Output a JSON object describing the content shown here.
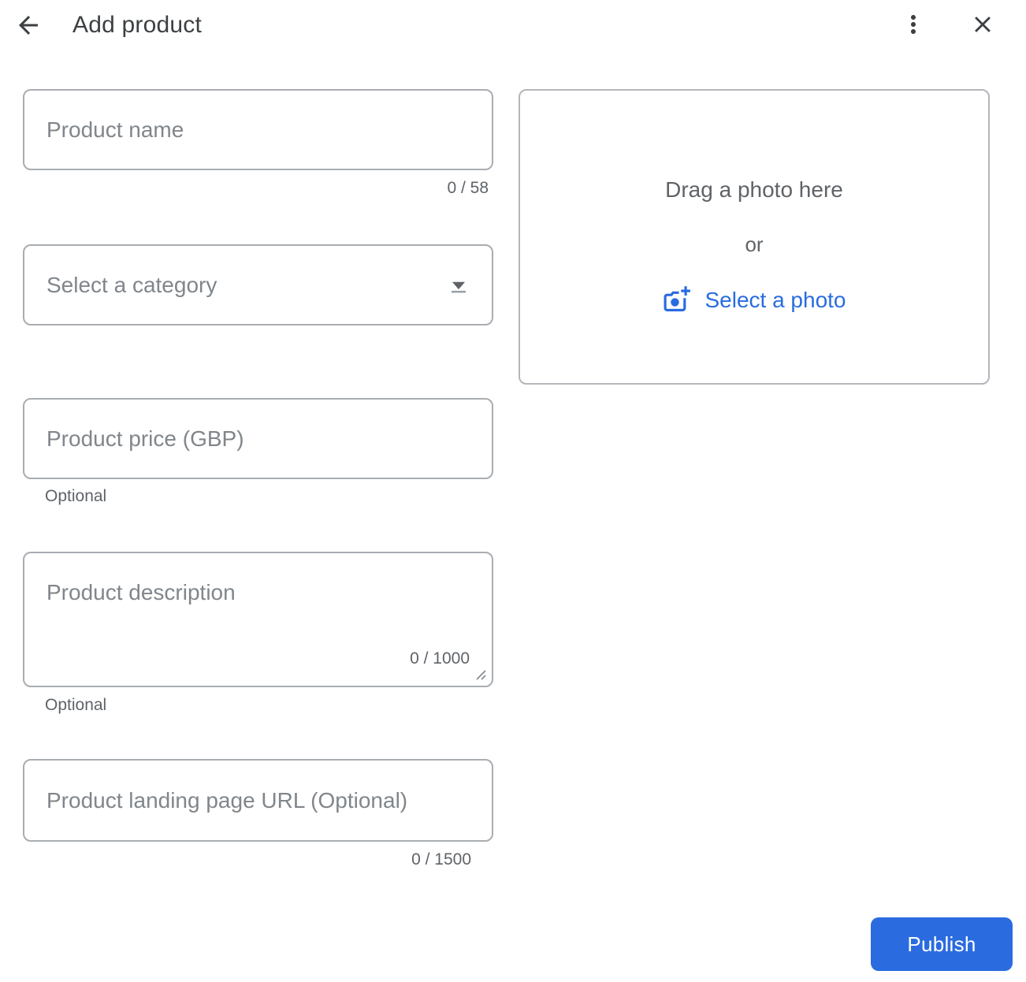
{
  "header": {
    "title": "Add product",
    "back_icon": "arrow-back",
    "more_icon": "more-vert",
    "close_icon": "close"
  },
  "form": {
    "product_name": {
      "value": "",
      "placeholder": "Product name",
      "counter": "0 / 58"
    },
    "category": {
      "selected": "Select a category",
      "dropdown_icon": "arrow-drop-down"
    },
    "price": {
      "value": "",
      "placeholder": "Product price (GBP)",
      "helper": "Optional"
    },
    "description": {
      "value": "",
      "placeholder": "Product description",
      "counter": "0 / 1000",
      "helper": "Optional"
    },
    "landing_url": {
      "value": "",
      "placeholder": "Product landing page URL (Optional)",
      "counter": "0 / 1500"
    }
  },
  "photo_upload": {
    "drag_text": "Drag a photo here",
    "or_text": "or",
    "select_label": "Select a photo",
    "select_icon": "add-a-photo"
  },
  "actions": {
    "publish_label": "Publish"
  },
  "colors": {
    "accent_blue": "#2a6ce0",
    "title_dark": "#3c4043",
    "text_gray": "#5f6368",
    "placeholder_gray": "#80868b",
    "field_border": "#a9adb2"
  }
}
